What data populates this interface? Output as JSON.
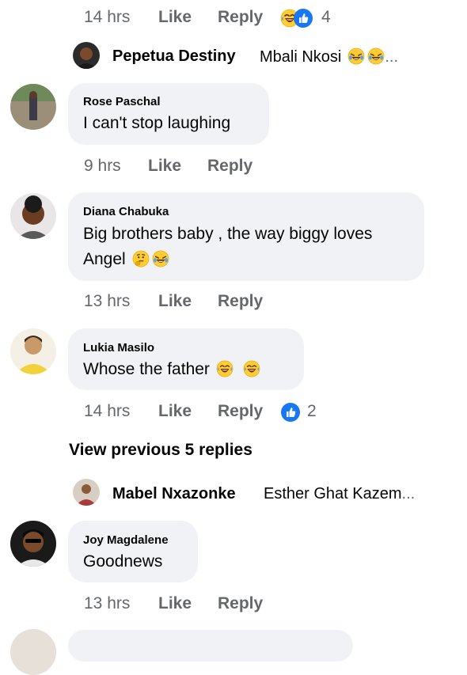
{
  "top_meta": {
    "time": "14 hrs",
    "like": "Like",
    "reply": "Reply",
    "reaction_count": "4"
  },
  "reply1": {
    "author": "Pepetua Destiny",
    "text": "Mbali Nkosi",
    "ellipsis": "..."
  },
  "comments": [
    {
      "author": "Rose Paschal",
      "lines": [
        "I can't stop laughing"
      ],
      "time": "9 hrs",
      "like": "Like",
      "reply": "Reply"
    },
    {
      "author": "Diana Chabuka",
      "lines": [
        "Big brothers baby , the way biggy loves",
        "Angel"
      ],
      "time": "13 hrs",
      "like": "Like",
      "reply": "Reply"
    },
    {
      "author": "Lukia Masilo",
      "lines": [
        "Whose the father"
      ],
      "time": "14 hrs",
      "like": "Like",
      "reply": "Reply",
      "reaction_count": "2"
    },
    {
      "author": "Joy Magdalene",
      "lines": [
        "Goodnews"
      ],
      "time": "13 hrs",
      "like": "Like",
      "reply": "Reply"
    }
  ],
  "view_previous": "View previous 5 replies",
  "reply2": {
    "author": "Mabel Nxazonke",
    "text": "Esther Ghat Kazem",
    "ellipsis": "..."
  },
  "icons": {
    "laughing": "rolling-on-floor-laughing-emoji",
    "tears": "tears-of-joy-emoji",
    "thinking": "thinking-face-emoji",
    "like_reaction": "like-reaction-icon"
  },
  "colors": {
    "bubble": "#f0f2f5",
    "meta": "#65676b",
    "like_blue": "#1877f2"
  }
}
